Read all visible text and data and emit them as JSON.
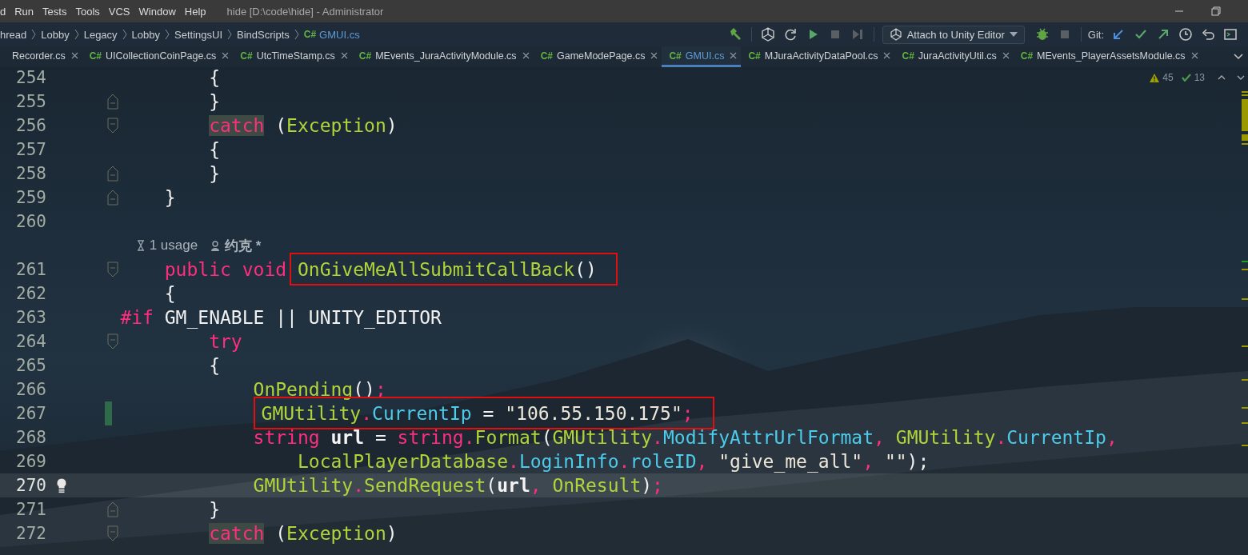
{
  "menu_bar": {
    "items": [
      "d",
      "Run",
      "Tests",
      "Tools",
      "VCS",
      "Window",
      "Help"
    ],
    "title": "hide [D:\\code\\hide] - Administrator"
  },
  "navigation_bar": {
    "breadcrumbs": [
      "hread",
      "Lobby",
      "Legacy",
      "Lobby",
      "SettingsUI",
      "BindScripts"
    ],
    "file": {
      "lang": "C#",
      "name": "GMUI.cs"
    },
    "attach_button": "Attach to Unity Editor",
    "git_label": "Git:"
  },
  "tabs": [
    {
      "name": "Recorder.cs",
      "selected": false
    },
    {
      "lang": "C#",
      "name": "UICollectionCoinPage.cs",
      "selected": false
    },
    {
      "lang": "C#",
      "name": "UtcTimeStamp.cs",
      "selected": false
    },
    {
      "lang": "C#",
      "name": "MEvents_JuraActivityModule.cs",
      "selected": false
    },
    {
      "lang": "C#",
      "name": "GameModePage.cs",
      "selected": false
    },
    {
      "lang": "C#",
      "name": "GMUI.cs",
      "selected": true
    },
    {
      "lang": "C#",
      "name": "MJuraActivityDataPool.cs",
      "selected": false
    },
    {
      "lang": "C#",
      "name": "JuraActivityUtil.cs",
      "selected": false
    },
    {
      "lang": "C#",
      "name": "MEvents_PlayerAssetsModule.cs",
      "selected": false
    }
  ],
  "inspections": {
    "warnings": "45",
    "passed": "13"
  },
  "editor": {
    "lines": [
      {
        "number": "254",
        "tokens": [
          {
            "text": "            {",
            "kind": "plain"
          }
        ]
      },
      {
        "number": "255",
        "fold_close": true,
        "tokens": [
          {
            "text": "            }",
            "kind": "plain"
          }
        ]
      },
      {
        "number": "256",
        "fold_open": true,
        "tokens": [
          {
            "text": "            catch",
            "kind": "kw",
            "marked": true
          },
          {
            "text": " (",
            "kind": "plain"
          },
          {
            "text": "Exception",
            "kind": "type"
          },
          {
            "text": ")",
            "kind": "plain"
          }
        ]
      },
      {
        "number": "257",
        "tokens": [
          {
            "text": "            {",
            "kind": "plain"
          }
        ]
      },
      {
        "number": "258",
        "fold_close": true,
        "tokens": [
          {
            "text": "            }",
            "kind": "plain"
          }
        ]
      },
      {
        "number": "259",
        "fold_close": true,
        "tokens": [
          {
            "text": "        }",
            "kind": "plain"
          }
        ]
      },
      {
        "number": "260"
      },
      {
        "number": "261",
        "fold_open": true,
        "inlay": {
          "usages": "1 usage",
          "author": "约克 *"
        },
        "tokens": [
          {
            "text": "        public void ",
            "kind": "kw"
          },
          {
            "text": "OnGiveMeAllSubmitCallBack",
            "kind": "type",
            "boxed": true
          },
          {
            "text": "()",
            "kind": "plain",
            "boxed": true
          }
        ]
      },
      {
        "number": "262",
        "tokens": [
          {
            "text": "        {",
            "kind": "plain"
          }
        ]
      },
      {
        "number": "263",
        "tokens": [
          {
            "text": "    #if",
            "kind": "kw"
          },
          {
            "text": " GM_ENABLE || UNITY_EDITOR",
            "kind": "plain"
          }
        ]
      },
      {
        "number": "264",
        "fold_open": true,
        "tokens": [
          {
            "text": "            try",
            "kind": "kw"
          }
        ]
      },
      {
        "number": "265",
        "tokens": [
          {
            "text": "            {",
            "kind": "plain"
          }
        ]
      },
      {
        "number": "266",
        "tokens": [
          {
            "text": "                OnPending",
            "kind": "type"
          },
          {
            "text": "()",
            "kind": "plain"
          },
          {
            "text": ";",
            "kind": "punct"
          }
        ]
      },
      {
        "number": "267",
        "changed": true,
        "tokens": [
          {
            "text": "                GMUtility",
            "kind": "type",
            "boxed": true
          },
          {
            "text": ".",
            "kind": "punct",
            "boxed": true
          },
          {
            "text": "CurrentIp",
            "kind": "prop",
            "boxed": true
          },
          {
            "text": " = ",
            "kind": "plain",
            "boxed": true
          },
          {
            "text": "\"106.55.150.175\"",
            "kind": "str",
            "boxed": true
          },
          {
            "text": ";",
            "kind": "punct",
            "boxed": true
          }
        ]
      },
      {
        "number": "268",
        "tokens": [
          {
            "text": "                string ",
            "kind": "kw"
          },
          {
            "text": "url",
            "kind": "local"
          },
          {
            "text": " = ",
            "kind": "plain"
          },
          {
            "text": "string",
            "kind": "kw"
          },
          {
            "text": ".",
            "kind": "punct"
          },
          {
            "text": "Format",
            "kind": "type"
          },
          {
            "text": "(",
            "kind": "plain"
          },
          {
            "text": "GMUtility",
            "kind": "type"
          },
          {
            "text": ".",
            "kind": "punct"
          },
          {
            "text": "ModifyAttrUrlFormat",
            "kind": "prop"
          },
          {
            "text": ", ",
            "kind": "punct"
          },
          {
            "text": "GMUtility",
            "kind": "type"
          },
          {
            "text": ".",
            "kind": "punct"
          },
          {
            "text": "CurrentIp",
            "kind": "prop"
          },
          {
            "text": ",",
            "kind": "punct"
          }
        ]
      },
      {
        "number": "269",
        "tokens": [
          {
            "text": "                    LocalPlayerDatabase",
            "kind": "type"
          },
          {
            "text": ".",
            "kind": "punct"
          },
          {
            "text": "LoginInfo",
            "kind": "prop"
          },
          {
            "text": ".",
            "kind": "punct"
          },
          {
            "text": "roleID",
            "kind": "prop"
          },
          {
            "text": ", ",
            "kind": "punct"
          },
          {
            "text": "\"give_me_all\"",
            "kind": "str"
          },
          {
            "text": ", ",
            "kind": "punct"
          },
          {
            "text": "\"\"",
            "kind": "str"
          },
          {
            "text": ");",
            "kind": "plain"
          }
        ]
      },
      {
        "number": "270",
        "current": true,
        "bulb": true,
        "tokens": [
          {
            "text": "                GMUtility",
            "kind": "type"
          },
          {
            "text": ".",
            "kind": "punct"
          },
          {
            "text": "SendRequest",
            "kind": "type"
          },
          {
            "text": "(",
            "kind": "plain"
          },
          {
            "text": "url",
            "kind": "local"
          },
          {
            "text": ", ",
            "kind": "punct"
          },
          {
            "text": "OnResult",
            "kind": "type"
          },
          {
            "text": ")",
            "kind": "plain"
          },
          {
            "text": ";",
            "kind": "punct"
          }
        ]
      },
      {
        "number": "271",
        "fold_close": true,
        "tokens": [
          {
            "text": "            }",
            "kind": "plain"
          }
        ]
      },
      {
        "number": "272",
        "fold_open": true,
        "tokens": [
          {
            "text": "            catch",
            "kind": "kw",
            "marked": true
          },
          {
            "text": " (",
            "kind": "plain"
          },
          {
            "text": "Exception",
            "kind": "type"
          },
          {
            "text": ")",
            "kind": "plain"
          }
        ]
      }
    ]
  }
}
